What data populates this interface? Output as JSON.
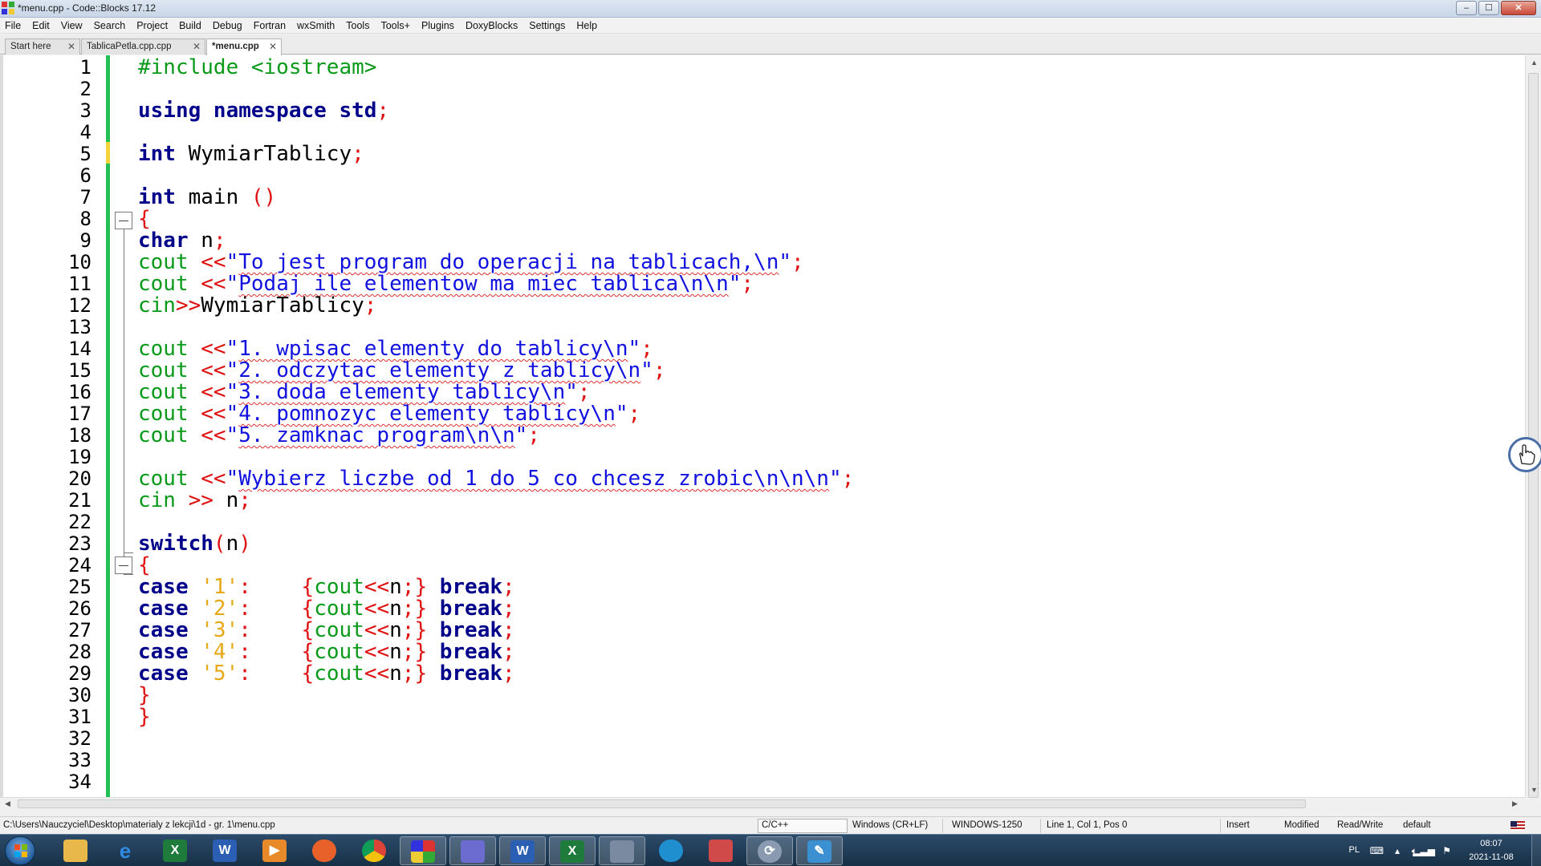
{
  "window": {
    "title": "*menu.cpp - Code::Blocks 17.12",
    "minimize": "‒",
    "maximize": "☐",
    "close": "✕"
  },
  "menubar": [
    "File",
    "Edit",
    "View",
    "Search",
    "Project",
    "Build",
    "Debug",
    "Fortran",
    "wxSmith",
    "Tools",
    "Tools+",
    "Plugins",
    "DoxyBlocks",
    "Settings",
    "Help"
  ],
  "tabs": [
    {
      "label": "Start here",
      "close": "✕",
      "active": false
    },
    {
      "label": "TablicaPetla.cpp.cpp",
      "close": "✕",
      "active": false
    },
    {
      "label": "*menu.cpp",
      "close": "✕",
      "active": true
    }
  ],
  "editor": {
    "line_numbers": [
      "1",
      "2",
      "3",
      "4",
      "5",
      "6",
      "7",
      "8",
      "9",
      "10",
      "11",
      "12",
      "13",
      "14",
      "15",
      "16",
      "17",
      "18",
      "19",
      "20",
      "21",
      "22",
      "23",
      "24",
      "25",
      "26",
      "27",
      "28",
      "29",
      "30",
      "31",
      "32",
      "33",
      "34"
    ],
    "tokens": {
      "l1": "#include <iostream>",
      "l3_kw": "using namespace std",
      "semi": ";",
      "int": "int",
      "l5_id": " WymiarTablicy",
      "l7_id": " main ",
      "parens": "()",
      "lbrace": "{",
      "rbrace": "}",
      "char": "char",
      "l9_id": " n",
      "cout": "cout",
      "cin": "cin",
      "ins": " <<",
      "q": "\"",
      "l10_str": "To jest program do operacji na tablicach,\\n",
      "l11_str": "Podaj ile elementow ma miec tablica\\n\\n",
      "l12_op": ">>",
      "l12_id": "WymiarTablicy",
      "l14_str": "1. wpisac elementy do tablicy\\n",
      "l15_str": "2. odczytac elementy z tablicy\\n",
      "l16_str": "3. doda elementy tablicy\\n",
      "l17_str": "4. pomnozyc elementy tablicy\\n",
      "l18_str": "5. zamknac program\\n\\n",
      "l20_str": "Wybierz liczbe od 1 do 5 co chcesz zrobic\\n\\n\\n",
      "l21_op": " >>",
      "sp_n": " n",
      "switch": "switch",
      "lparen": "(",
      "rparen": ")",
      "n": "n",
      "case": "case",
      "c1": "'1'",
      "c2": "'2'",
      "c3": "'3'",
      "c4": "'4'",
      "c5": "'5'",
      "colon": ":",
      "shl": "<<",
      "brk": "break"
    }
  },
  "statusbar": {
    "path": "C:\\Users\\Nauczyciel\\Desktop\\materialy z lekcji\\1d - gr. 1\\menu.cpp",
    "language": "C/C++",
    "eol": "Windows (CR+LF)",
    "encoding": "WINDOWS-1250",
    "position": "Line 1, Col 1, Pos 0",
    "mode": "Insert",
    "modified": "Modified",
    "access": "Read/Write",
    "profile": "default"
  },
  "taskbar": {
    "apps": [
      {
        "icon": "file-explorer-icon",
        "color": "#e8b84a"
      },
      {
        "icon": "internet-explorer-icon",
        "color": "#2f8be0"
      },
      {
        "icon": "excel-icon",
        "color": "#1e7b3c"
      },
      {
        "icon": "word-icon",
        "color": "#2b5fb4"
      },
      {
        "icon": "media-player-icon",
        "color": "#e88a2a"
      },
      {
        "icon": "firefox-icon",
        "color": "#e8612a"
      },
      {
        "icon": "chrome-icon",
        "color": "#4caf50"
      },
      {
        "icon": "codeblocks-icon",
        "color": "#c8a030"
      },
      {
        "icon": "save-disk-icon",
        "color": "#6b6bd0"
      },
      {
        "icon": "word-doc-icon",
        "color": "#2b5fb4"
      },
      {
        "icon": "excel-doc-icon",
        "color": "#1e7b3c"
      },
      {
        "icon": "network-icon",
        "color": "#7a8aa0"
      },
      {
        "icon": "edge-icon",
        "color": "#1f8fd0"
      },
      {
        "icon": "paint-icon",
        "color": "#d04a4a"
      },
      {
        "icon": "sync-icon",
        "color": "#8a9ab0"
      },
      {
        "icon": "notepad-icon",
        "color": "#3a90d0"
      }
    ],
    "tray": {
      "language": "PL",
      "time": "08:07",
      "date": "2021-11-08"
    }
  }
}
